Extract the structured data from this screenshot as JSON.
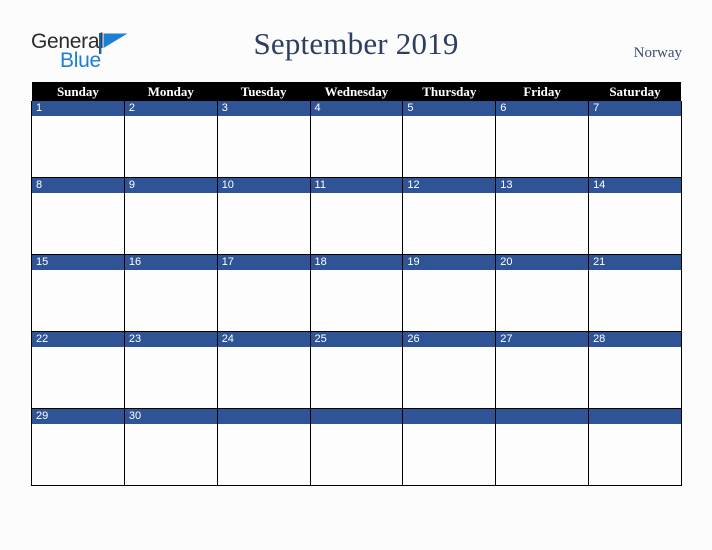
{
  "brand": {
    "name_part1": "General",
    "name_part2": "Blue",
    "mark": "triangle-logo-icon",
    "color_dark": "#2b2b2b",
    "color_blue": "#1b7fd4"
  },
  "header": {
    "title": "September 2019",
    "country": "Norway",
    "title_color": "#2c3e63"
  },
  "calendar": {
    "month": "September",
    "year": "2019",
    "accent_color": "#2e5496",
    "header_bg": "#000000",
    "header_fg": "#ffffff",
    "weekday_headers": [
      "Sunday",
      "Monday",
      "Tuesday",
      "Wednesday",
      "Thursday",
      "Friday",
      "Saturday"
    ],
    "weeks": [
      [
        {
          "day": "1"
        },
        {
          "day": "2"
        },
        {
          "day": "3"
        },
        {
          "day": "4"
        },
        {
          "day": "5"
        },
        {
          "day": "6"
        },
        {
          "day": "7"
        }
      ],
      [
        {
          "day": "8"
        },
        {
          "day": "9"
        },
        {
          "day": "10"
        },
        {
          "day": "11"
        },
        {
          "day": "12"
        },
        {
          "day": "13"
        },
        {
          "day": "14"
        }
      ],
      [
        {
          "day": "15"
        },
        {
          "day": "16"
        },
        {
          "day": "17"
        },
        {
          "day": "18"
        },
        {
          "day": "19"
        },
        {
          "day": "20"
        },
        {
          "day": "21"
        }
      ],
      [
        {
          "day": "22"
        },
        {
          "day": "23"
        },
        {
          "day": "24"
        },
        {
          "day": "25"
        },
        {
          "day": "26"
        },
        {
          "day": "27"
        },
        {
          "day": "28"
        }
      ],
      [
        {
          "day": "29"
        },
        {
          "day": "30"
        },
        {
          "day": ""
        },
        {
          "day": ""
        },
        {
          "day": ""
        },
        {
          "day": ""
        },
        {
          "day": ""
        }
      ]
    ]
  }
}
